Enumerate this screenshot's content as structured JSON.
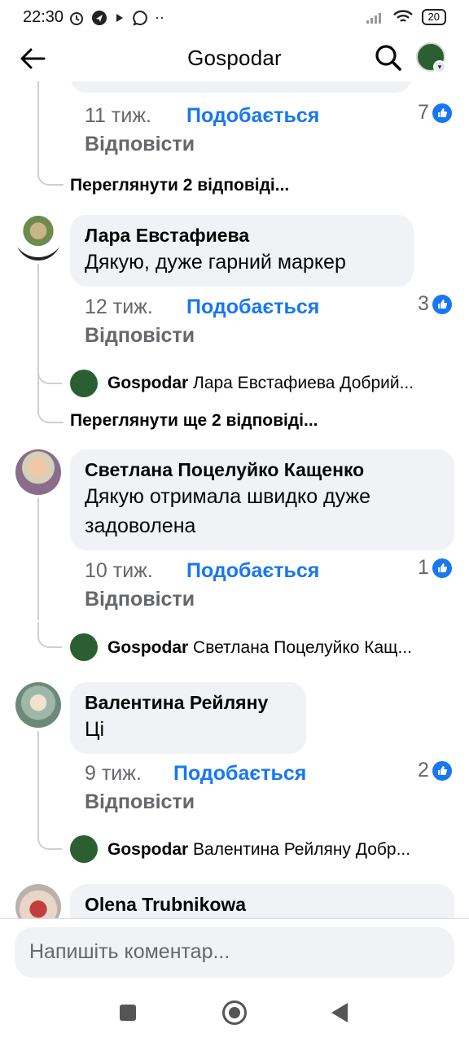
{
  "status_bar": {
    "time": "22:30",
    "battery": "20"
  },
  "header": {
    "title": "Gospodar"
  },
  "comments": [
    {
      "time": "11 тиж.",
      "like_label": "Подобається",
      "reply_label": "Відповісти",
      "reaction_count": "7",
      "view_replies": "Переглянути 2 відповіді..."
    },
    {
      "author": "Лара Евстафиева",
      "text": "Дякую, дуже гарний маркер",
      "time": "12 тиж.",
      "like_label": "Подобається",
      "reply_label": "Відповісти",
      "reaction_count": "3",
      "reply_preview_author": "Gospodar",
      "reply_preview_text": "Лара Евстафиева Добрий...",
      "view_replies": "Переглянути ще 2 відповіді..."
    },
    {
      "author": "Светлана Поцелуйко Кащенко",
      "text_line1": "Дякую отримала швидко дуже",
      "text_line2": "задоволена",
      "time": "10 тиж.",
      "like_label": "Подобається",
      "reply_label": "Відповісти",
      "reaction_count": "1",
      "reply_preview_author": "Gospodar",
      "reply_preview_text": "Светлана Поцелуйко Кащ..."
    },
    {
      "author": "Валентина Рейляну",
      "text": "Ці",
      "time": "9 тиж.",
      "like_label": "Подобається",
      "reply_label": "Відповісти",
      "reaction_count": "2",
      "reply_preview_author": "Gospodar",
      "reply_preview_text": "Валентина Рейляну Добр..."
    },
    {
      "author": "Olena Trubnikowa"
    }
  ],
  "composer": {
    "placeholder": "Напишіть коментар..."
  },
  "colors": {
    "accent_blue": "#1877f2",
    "bubble_bg": "#f0f2f5",
    "muted_text": "#65676b",
    "brand_green": "#2b5f31"
  }
}
